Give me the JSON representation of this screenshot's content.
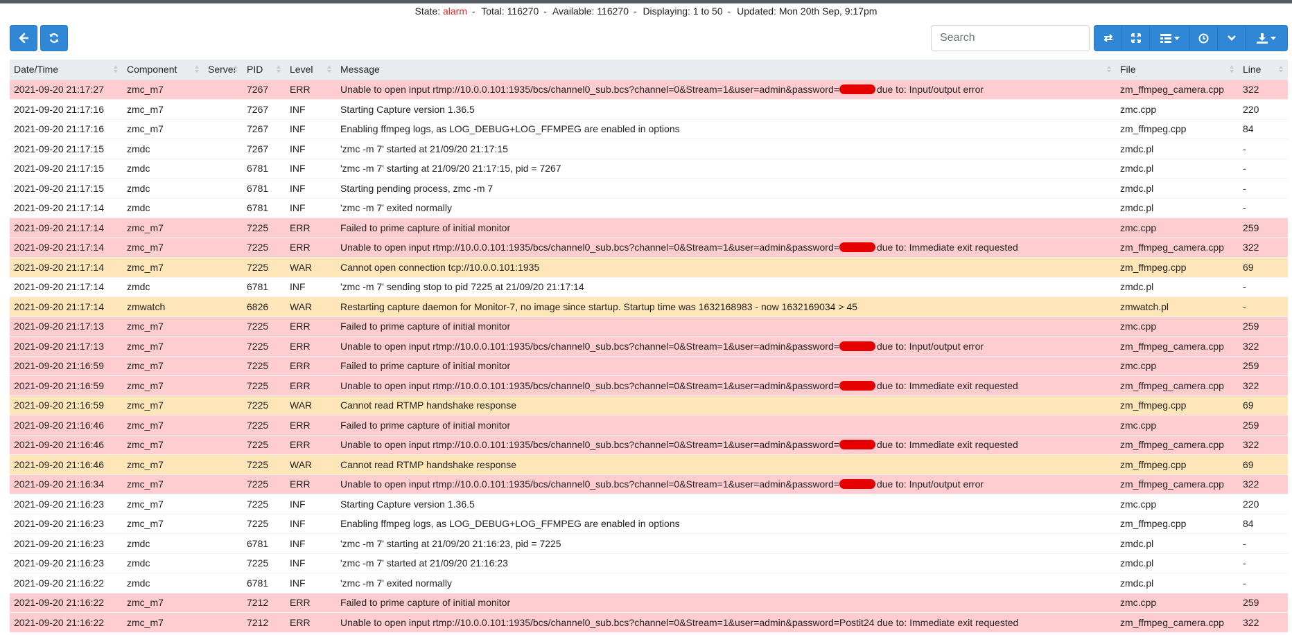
{
  "status": {
    "state_label": "State:",
    "state_value": "alarm",
    "total_label": "Total:",
    "total_value": "116270",
    "available_label": "Available:",
    "available_value": "116270",
    "displaying_label": "Displaying:",
    "displaying_value": "1 to 50",
    "updated_label": "Updated:",
    "updated_value": "Mon 20th Sep, 9:17pm"
  },
  "toolbar": {
    "back_icon": "arrow-left-icon",
    "refresh_icon": "refresh-icon",
    "search_placeholder": "Search",
    "tools": [
      "toggle-icon",
      "fullscreen-icon",
      "columns-icon",
      "auto-refresh-icon",
      "chevron-down-icon",
      "download-icon"
    ]
  },
  "colors": {
    "button_blue": "#2f87d6",
    "row_error": "#ffcdd0",
    "row_warning": "#fee6b8",
    "alarm_text": "#d9262b",
    "redaction": "#e50000"
  },
  "columns": [
    "Date/Time",
    "Component",
    "Server",
    "PID",
    "Level",
    "Message",
    "File",
    "Line"
  ],
  "rows": [
    {
      "dt": "2021-09-20 21:17:27",
      "comp": "zmc_m7",
      "server": "",
      "pid": "7267",
      "level": "ERR",
      "pre": "Unable to open input rtmp://10.0.0.101:1935/bcs/channel0_sub.bcs?channel=0&Stream=1&user=admin&password=",
      "redacted": true,
      "post": "due to: Input/output error",
      "file": "zm_ffmpeg_camera.cpp",
      "line": "322"
    },
    {
      "dt": "2021-09-20 21:17:16",
      "comp": "zmc_m7",
      "server": "",
      "pid": "7267",
      "level": "INF",
      "pre": "Starting Capture version 1.36.5",
      "redacted": false,
      "post": "",
      "file": "zmc.cpp",
      "line": "220"
    },
    {
      "dt": "2021-09-20 21:17:16",
      "comp": "zmc_m7",
      "server": "",
      "pid": "7267",
      "level": "INF",
      "pre": "Enabling ffmpeg logs, as LOG_DEBUG+LOG_FFMPEG are enabled in options",
      "redacted": false,
      "post": "",
      "file": "zm_ffmpeg.cpp",
      "line": "84"
    },
    {
      "dt": "2021-09-20 21:17:15",
      "comp": "zmdc",
      "server": "",
      "pid": "7267",
      "level": "INF",
      "pre": "'zmc -m 7' started at 21/09/20 21:17:15",
      "redacted": false,
      "post": "",
      "file": "zmdc.pl",
      "line": "-"
    },
    {
      "dt": "2021-09-20 21:17:15",
      "comp": "zmdc",
      "server": "",
      "pid": "6781",
      "level": "INF",
      "pre": "'zmc -m 7' starting at 21/09/20 21:17:15, pid = 7267",
      "redacted": false,
      "post": "",
      "file": "zmdc.pl",
      "line": "-"
    },
    {
      "dt": "2021-09-20 21:17:15",
      "comp": "zmdc",
      "server": "",
      "pid": "6781",
      "level": "INF",
      "pre": "Starting pending process, zmc -m 7",
      "redacted": false,
      "post": "",
      "file": "zmdc.pl",
      "line": "-"
    },
    {
      "dt": "2021-09-20 21:17:14",
      "comp": "zmdc",
      "server": "",
      "pid": "6781",
      "level": "INF",
      "pre": "'zmc -m 7' exited normally",
      "redacted": false,
      "post": "",
      "file": "zmdc.pl",
      "line": "-"
    },
    {
      "dt": "2021-09-20 21:17:14",
      "comp": "zmc_m7",
      "server": "",
      "pid": "7225",
      "level": "ERR",
      "pre": "Failed to prime capture of initial monitor",
      "redacted": false,
      "post": "",
      "file": "zmc.cpp",
      "line": "259"
    },
    {
      "dt": "2021-09-20 21:17:14",
      "comp": "zmc_m7",
      "server": "",
      "pid": "7225",
      "level": "ERR",
      "pre": "Unable to open input rtmp://10.0.0.101:1935/bcs/channel0_sub.bcs?channel=0&Stream=1&user=admin&password=",
      "redacted": true,
      "post": "due to: Immediate exit requested",
      "file": "zm_ffmpeg_camera.cpp",
      "line": "322"
    },
    {
      "dt": "2021-09-20 21:17:14",
      "comp": "zmc_m7",
      "server": "",
      "pid": "7225",
      "level": "WAR",
      "pre": "Cannot open connection tcp://10.0.0.101:1935",
      "redacted": false,
      "post": "",
      "file": "zm_ffmpeg.cpp",
      "line": "69"
    },
    {
      "dt": "2021-09-20 21:17:14",
      "comp": "zmdc",
      "server": "",
      "pid": "6781",
      "level": "INF",
      "pre": "'zmc -m 7' sending stop to pid 7225 at 21/09/20 21:17:14",
      "redacted": false,
      "post": "",
      "file": "zmdc.pl",
      "line": "-"
    },
    {
      "dt": "2021-09-20 21:17:14",
      "comp": "zmwatch",
      "server": "",
      "pid": "6826",
      "level": "WAR",
      "pre": "Restarting capture daemon for Monitor-7, no image since startup. Startup time was 1632168983 - now 1632169034 > 45",
      "redacted": false,
      "post": "",
      "file": "zmwatch.pl",
      "line": "-"
    },
    {
      "dt": "2021-09-20 21:17:13",
      "comp": "zmc_m7",
      "server": "",
      "pid": "7225",
      "level": "ERR",
      "pre": "Failed to prime capture of initial monitor",
      "redacted": false,
      "post": "",
      "file": "zmc.cpp",
      "line": "259"
    },
    {
      "dt": "2021-09-20 21:17:13",
      "comp": "zmc_m7",
      "server": "",
      "pid": "7225",
      "level": "ERR",
      "pre": "Unable to open input rtmp://10.0.0.101:1935/bcs/channel0_sub.bcs?channel=0&Stream=1&user=admin&password=",
      "redacted": true,
      "post": "due to: Input/output error",
      "file": "zm_ffmpeg_camera.cpp",
      "line": "322"
    },
    {
      "dt": "2021-09-20 21:16:59",
      "comp": "zmc_m7",
      "server": "",
      "pid": "7225",
      "level": "ERR",
      "pre": "Failed to prime capture of initial monitor",
      "redacted": false,
      "post": "",
      "file": "zmc.cpp",
      "line": "259"
    },
    {
      "dt": "2021-09-20 21:16:59",
      "comp": "zmc_m7",
      "server": "",
      "pid": "7225",
      "level": "ERR",
      "pre": "Unable to open input rtmp://10.0.0.101:1935/bcs/channel0_sub.bcs?channel=0&Stream=1&user=admin&password=",
      "redacted": true,
      "post": "due to: Immediate exit requested",
      "file": "zm_ffmpeg_camera.cpp",
      "line": "322"
    },
    {
      "dt": "2021-09-20 21:16:59",
      "comp": "zmc_m7",
      "server": "",
      "pid": "7225",
      "level": "WAR",
      "pre": "Cannot read RTMP handshake response",
      "redacted": false,
      "post": "",
      "file": "zm_ffmpeg.cpp",
      "line": "69"
    },
    {
      "dt": "2021-09-20 21:16:46",
      "comp": "zmc_m7",
      "server": "",
      "pid": "7225",
      "level": "ERR",
      "pre": "Failed to prime capture of initial monitor",
      "redacted": false,
      "post": "",
      "file": "zmc.cpp",
      "line": "259"
    },
    {
      "dt": "2021-09-20 21:16:46",
      "comp": "zmc_m7",
      "server": "",
      "pid": "7225",
      "level": "ERR",
      "pre": "Unable to open input rtmp://10.0.0.101:1935/bcs/channel0_sub.bcs?channel=0&Stream=1&user=admin&password=",
      "redacted": true,
      "post": "due to: Immediate exit requested",
      "file": "zm_ffmpeg_camera.cpp",
      "line": "322"
    },
    {
      "dt": "2021-09-20 21:16:46",
      "comp": "zmc_m7",
      "server": "",
      "pid": "7225",
      "level": "WAR",
      "pre": "Cannot read RTMP handshake response",
      "redacted": false,
      "post": "",
      "file": "zm_ffmpeg.cpp",
      "line": "69"
    },
    {
      "dt": "2021-09-20 21:16:34",
      "comp": "zmc_m7",
      "server": "",
      "pid": "7225",
      "level": "ERR",
      "pre": "Unable to open input rtmp://10.0.0.101:1935/bcs/channel0_sub.bcs?channel=0&Stream=1&user=admin&password=",
      "redacted": true,
      "post": "due to: Input/output error",
      "file": "zm_ffmpeg_camera.cpp",
      "line": "322"
    },
    {
      "dt": "2021-09-20 21:16:23",
      "comp": "zmc_m7",
      "server": "",
      "pid": "7225",
      "level": "INF",
      "pre": "Starting Capture version 1.36.5",
      "redacted": false,
      "post": "",
      "file": "zmc.cpp",
      "line": "220"
    },
    {
      "dt": "2021-09-20 21:16:23",
      "comp": "zmc_m7",
      "server": "",
      "pid": "7225",
      "level": "INF",
      "pre": "Enabling ffmpeg logs, as LOG_DEBUG+LOG_FFMPEG are enabled in options",
      "redacted": false,
      "post": "",
      "file": "zm_ffmpeg.cpp",
      "line": "84"
    },
    {
      "dt": "2021-09-20 21:16:23",
      "comp": "zmdc",
      "server": "",
      "pid": "6781",
      "level": "INF",
      "pre": "'zmc -m 7' starting at 21/09/20 21:16:23, pid = 7225",
      "redacted": false,
      "post": "",
      "file": "zmdc.pl",
      "line": "-"
    },
    {
      "dt": "2021-09-20 21:16:23",
      "comp": "zmdc",
      "server": "",
      "pid": "7225",
      "level": "INF",
      "pre": "'zmc -m 7' started at 21/09/20 21:16:23",
      "redacted": false,
      "post": "",
      "file": "zmdc.pl",
      "line": "-"
    },
    {
      "dt": "2021-09-20 21:16:22",
      "comp": "zmdc",
      "server": "",
      "pid": "6781",
      "level": "INF",
      "pre": "'zmc -m 7' exited normally",
      "redacted": false,
      "post": "",
      "file": "zmdc.pl",
      "line": "-"
    },
    {
      "dt": "2021-09-20 21:16:22",
      "comp": "zmc_m7",
      "server": "",
      "pid": "7212",
      "level": "ERR",
      "pre": "Failed to prime capture of initial monitor",
      "redacted": false,
      "post": "",
      "file": "zmc.cpp",
      "line": "259"
    },
    {
      "dt": "2021-09-20 21:16:22",
      "comp": "zmc_m7",
      "server": "",
      "pid": "7212",
      "level": "ERR",
      "pre": "Unable to open input rtmp://10.0.0.101:1935/bcs/channel0_sub.bcs?channel=0&Stream=1&user=admin&password=Postit24 due to: Immediate exit requested",
      "redacted": false,
      "post": "",
      "file": "zm_ffmpeg_camera.cpp",
      "line": "322"
    }
  ]
}
